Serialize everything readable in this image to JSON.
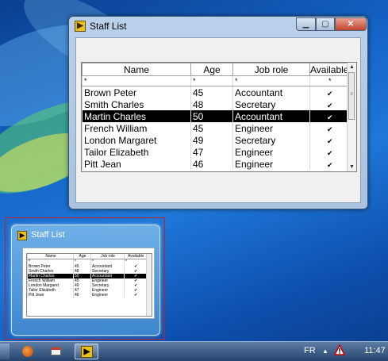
{
  "window": {
    "title": "Staff List",
    "app_icon_glyph": "▶",
    "controls": {
      "minimize": "▁",
      "maximize": "▢",
      "close": "✕"
    },
    "table": {
      "columns": [
        "Name",
        "Age",
        "Job role",
        "Available"
      ],
      "filter_row": [
        "*",
        "*",
        "*",
        "*"
      ],
      "rows": [
        {
          "name": "Brown Peter",
          "age": "45",
          "role": "Accountant",
          "available": true
        },
        {
          "name": "Smith Charles",
          "age": "48",
          "role": "Secretary",
          "available": true
        },
        {
          "name": "Martin Charles",
          "age": "50",
          "role": "Accountant",
          "available": true,
          "selected": true
        },
        {
          "name": "French William",
          "age": "45",
          "role": "Engineer",
          "available": true
        },
        {
          "name": "London Margaret",
          "age": "49",
          "role": "Secretary",
          "available": true
        },
        {
          "name": "Tailor Elizabeth",
          "age": "47",
          "role": "Engineer",
          "available": true
        },
        {
          "name": "Pitt  Jean",
          "age": "46",
          "role": "Engineer",
          "available": true
        }
      ],
      "check_glyph": "✔"
    }
  },
  "preview": {
    "title": "Staff List",
    "columns": [
      "Name",
      "Age",
      "Job role",
      "Available"
    ]
  },
  "taskbar": {
    "language": "FR",
    "clock": "11:47",
    "tray_up_arrow": "▲"
  },
  "colors": {
    "selection_bg": "#000000",
    "preview_highlight": "#c2202a",
    "close_button": "#c5452e"
  }
}
